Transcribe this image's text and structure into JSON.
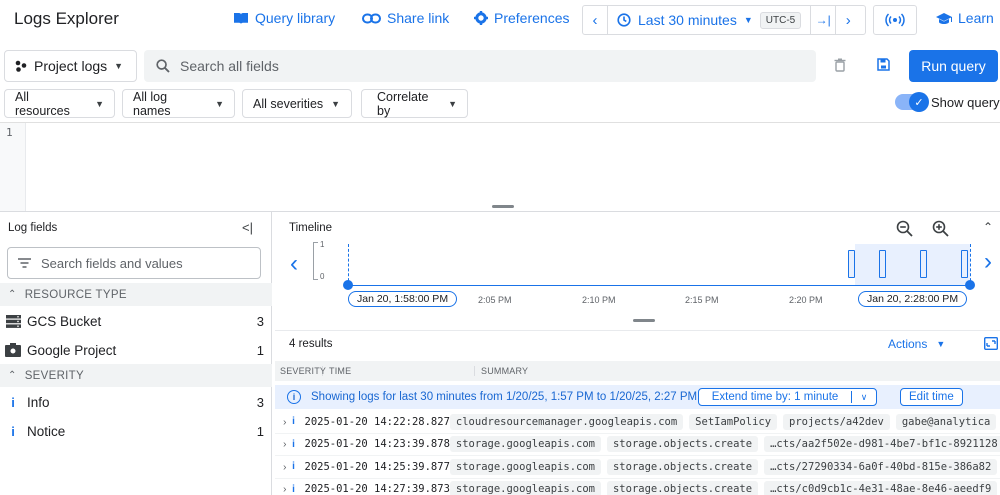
{
  "header": {
    "title": "Logs Explorer",
    "query_library": "Query library",
    "share_link": "Share link",
    "preferences": "Preferences",
    "time_range": "Last 30 minutes",
    "timezone": "UTC-5",
    "learn": "Learn"
  },
  "query": {
    "scope": "Project logs",
    "search_placeholder": "Search all fields",
    "run_label": "Run query"
  },
  "filters": {
    "resources": "All resources",
    "log_names": "All log names",
    "severities": "All severities",
    "correlate": "Correlate by",
    "show_query": "Show query"
  },
  "editor": {
    "line_number": "1"
  },
  "log_fields": {
    "title": "Log fields",
    "search_placeholder": "Search fields and values",
    "sections": [
      {
        "label": "RESOURCE TYPE",
        "items": [
          {
            "label": "GCS Bucket",
            "count": "3"
          },
          {
            "label": "Google Project",
            "count": "1"
          }
        ]
      },
      {
        "label": "SEVERITY",
        "items": [
          {
            "label": "Info",
            "count": "3"
          },
          {
            "label": "Notice",
            "count": "1"
          }
        ]
      }
    ]
  },
  "timeline": {
    "title": "Timeline",
    "y_max": "1",
    "y_min": "0",
    "start_label": "Jan 20, 1:58:00 PM",
    "end_label": "Jan 20, 2:28:00 PM",
    "ticks": [
      "2:05 PM",
      "2:10 PM",
      "2:15 PM",
      "2:20 PM"
    ]
  },
  "results": {
    "count": "4 results",
    "actions": "Actions",
    "col_severity": "SEVERITY",
    "col_time": "TIME",
    "col_summary": "SUMMARY",
    "info_text": "Showing logs for last 30 minutes from 1/20/25, 1:57 PM to 1/20/25, 2:27 PM.",
    "extend_label": "Extend time by: 1 minute",
    "edit_time": "Edit time",
    "rows": [
      {
        "time": "2025-01-20 14:22:28.827",
        "chips": [
          "cloudresourcemanager.googleapis.com",
          "SetIamPolicy",
          "projects/a42dev",
          "gabe@analytica"
        ]
      },
      {
        "time": "2025-01-20 14:23:39.878",
        "chips": [
          "storage.googleapis.com",
          "storage.objects.create",
          "…cts/aa2f502e-d981-4be7-bf1c-8921128"
        ]
      },
      {
        "time": "2025-01-20 14:25:39.877",
        "chips": [
          "storage.googleapis.com",
          "storage.objects.create",
          "…cts/27290334-6a0f-40bd-815e-386a82"
        ]
      },
      {
        "time": "2025-01-20 14:27:39.873",
        "chips": [
          "storage.googleapis.com",
          "storage.objects.create",
          "…cts/c0d9cb1c-4e31-48ae-8e46-aeedf9"
        ]
      }
    ]
  },
  "icons": {
    "scope": "project-nodes-icon",
    "search": "magnifier-icon",
    "clock": "clock-icon",
    "stream": "stream-icon",
    "info": "info-icon"
  },
  "colors": {
    "accent": "#1a73e8",
    "info_bg": "#e8f0fe"
  }
}
